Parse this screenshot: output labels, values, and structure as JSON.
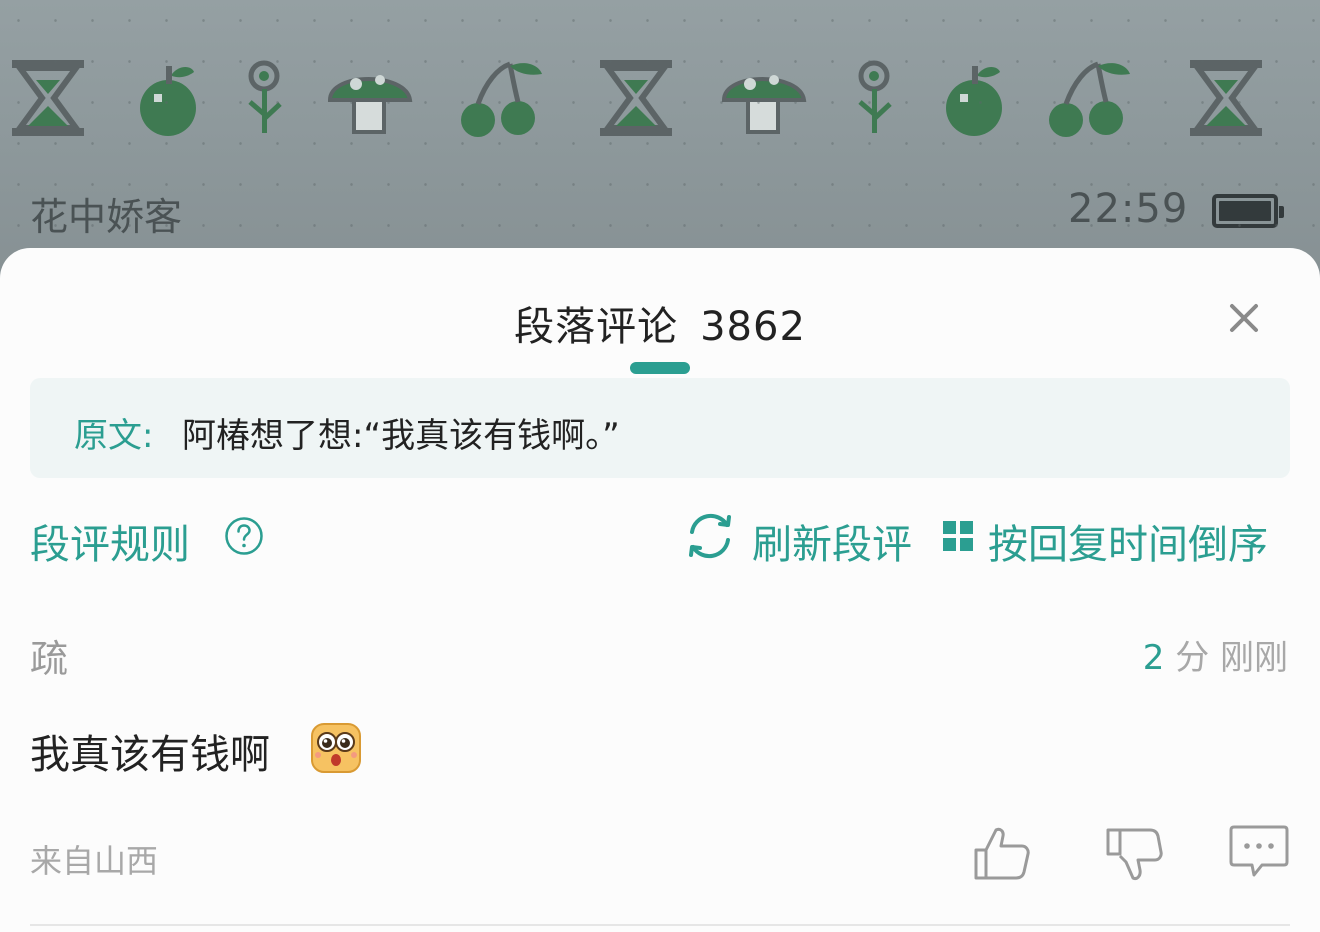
{
  "background": {
    "book_title": "花中娇客",
    "clock": "22:59",
    "pixel_icons": [
      "hourglass-icon",
      "apple-icon",
      "flower-icon",
      "mushroom-icon",
      "cherry-icon",
      "hourglass-icon",
      "mushroom-icon",
      "flower-icon",
      "apple-icon",
      "cherry-icon",
      "hourglass-icon"
    ]
  },
  "panel": {
    "title": "段落评论",
    "count": "3862",
    "quote_label": "原文:",
    "quote_text": "阿椿想了想:“我真该有钱啊。”",
    "rules_label": "段评规则",
    "refresh_label": "刷新段评",
    "sort_label": "按回复时间倒序"
  },
  "comments": [
    {
      "user": "疏",
      "score": "2",
      "score_unit": "分",
      "time": "刚刚",
      "text": "我真该有钱啊",
      "location": "来自山西"
    }
  ],
  "colors": {
    "accent": "#2b9e91",
    "sheet_bg": "#fcfcfc",
    "quote_bg": "#eff5f5",
    "muted_text": "#a8a8a8",
    "pixel_green": "#3f7a52"
  }
}
